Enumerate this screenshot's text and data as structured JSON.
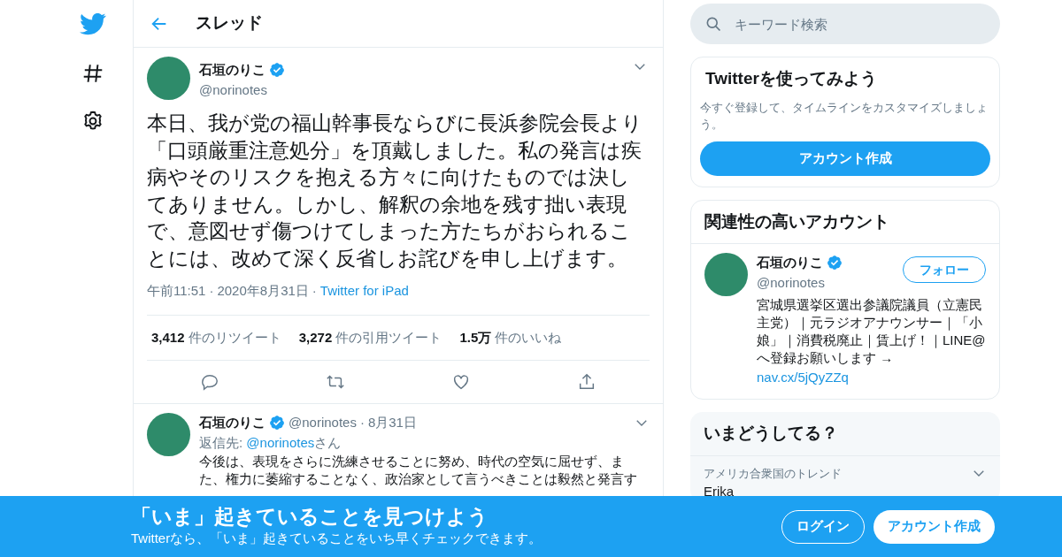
{
  "header": {
    "title": "スレッド"
  },
  "tweet": {
    "name": "石垣のりこ",
    "verified": true,
    "handle": "@norinotes",
    "text": "本日、我が党の福山幹事長ならびに長浜参院会長より「口頭厳重注意処分」を頂戴しました。私の発言は疾病やそのリスクを抱える方々に向けたものでは決してありません。しかし、解釈の余地を残す拙い表現で、意図せず傷つけてしまった方たちがおられることには、改めて深く反省しお詫びを申し上げます。",
    "time": "午前11:51",
    "sep": "·",
    "date": "2020年8月31日",
    "source": "Twitter for iPad",
    "stats": [
      {
        "count": "3,412",
        "label": "件のリツイート"
      },
      {
        "count": "3,272",
        "label": "件の引用ツイート"
      },
      {
        "count": "1.5万",
        "label": "件のいいね"
      }
    ]
  },
  "reply": {
    "name": "石垣のりこ",
    "verified": true,
    "handle": "@norinotes",
    "sep": "·",
    "date": "8月31日",
    "reply_prefix": "返信先:",
    "reply_to": "@norinotes",
    "reply_suffix": "さん",
    "text": "今後は、表現をさらに洗練させることに努め、時代の空気に屈せず、また、権力に萎縮することなく、政治家として言うべきことは毅然と発言す"
  },
  "search": {
    "placeholder": "キーワード検索"
  },
  "signup_card": {
    "title": "Twitterを使ってみよう",
    "text": "今すぐ登録して、タイムラインをカスタマイズしましょう。",
    "button": "アカウント作成"
  },
  "related": {
    "title": "関連性の高いアカウント",
    "name": "石垣のりこ",
    "verified": true,
    "handle": "@norinotes",
    "follow": "フォロー",
    "bio": "宮城県選挙区選出参議院議員（立憲民主党）｜元ラジオアナウンサー｜「小娘」｜消費税廃止｜賃上げ！｜LINE@へ登録お願いします →",
    "link": "nav.cx/5jQyZZq"
  },
  "trends": {
    "title": "いまどうしてる？",
    "items": [
      {
        "context": "アメリカ合衆国のトレンド",
        "name": "Erika"
      }
    ]
  },
  "banner": {
    "title": "「いま」起きていることを見つけよう",
    "text": "Twitterなら、「いま」起きていることをいち早くチェックできます。",
    "login": "ログイン",
    "signup": "アカウント作成"
  }
}
